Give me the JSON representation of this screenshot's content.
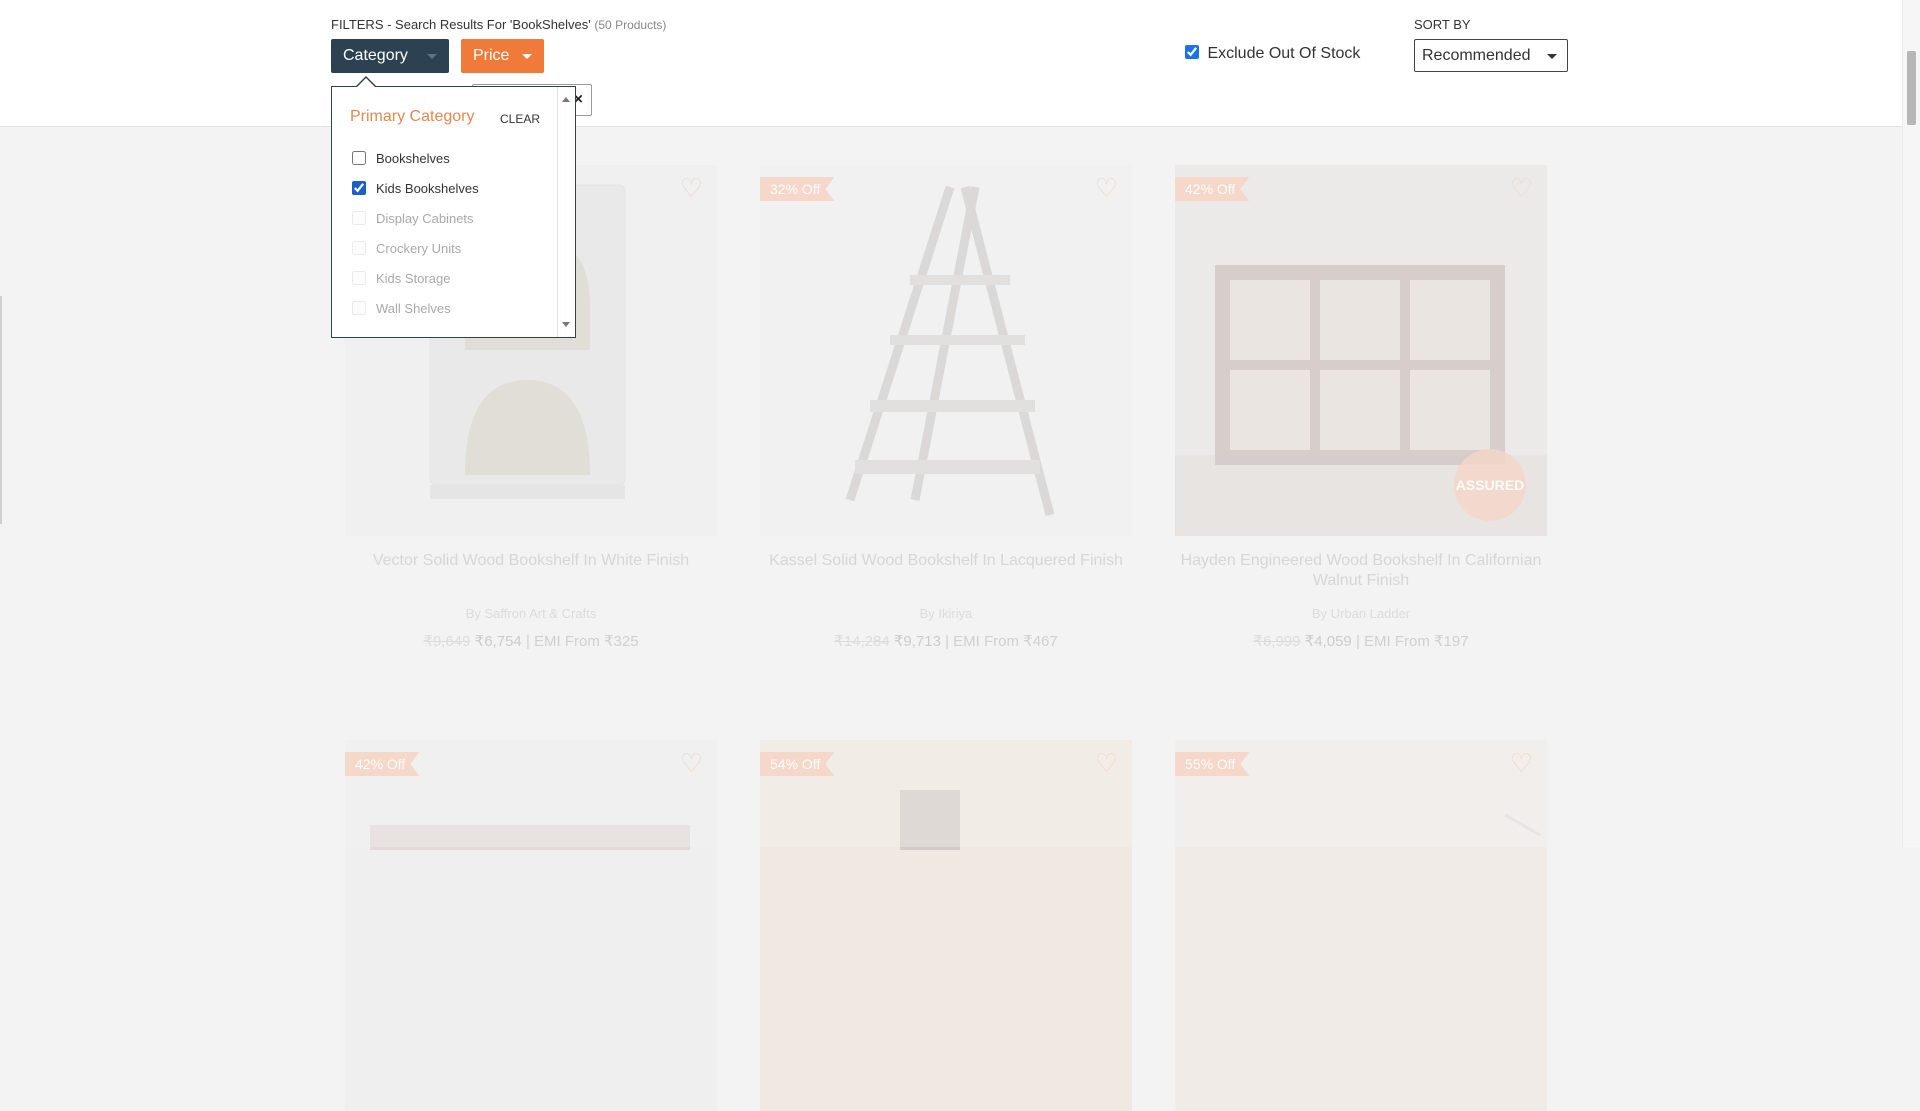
{
  "filterbar": {
    "title": "FILTERS - Search Results For 'BookShelves'",
    "count": "(50 Products)",
    "category_label": "Category",
    "price_label": "Price",
    "exclude_label": "Exclude Out Of Stock",
    "exclude_checked": true,
    "sort_label": "SORT BY",
    "sort_value": "Recommended"
  },
  "category_dropdown": {
    "heading": "Primary Category",
    "clear_label": "CLEAR",
    "items": [
      {
        "label": "Bookshelves",
        "checked": false,
        "enabled": true
      },
      {
        "label": "Kids Bookshelves",
        "checked": true,
        "enabled": true
      },
      {
        "label": "Display Cabinets",
        "checked": false,
        "enabled": false
      },
      {
        "label": "Crockery Units",
        "checked": false,
        "enabled": false
      },
      {
        "label": "Kids Storage",
        "checked": false,
        "enabled": false
      },
      {
        "label": "Wall Shelves",
        "checked": false,
        "enabled": false
      }
    ]
  },
  "products": [
    {
      "badge": "",
      "name": "Vector Solid Wood Bookshelf In White Finish",
      "brand": "By Saffron Art & Crafts",
      "mrp": "₹9,649",
      "price": "₹6,754",
      "emi": "| EMI From ₹325"
    },
    {
      "badge": "32% Off",
      "name": "Kassel Solid Wood Bookshelf In Lacquered Finish",
      "brand": "By Ikiriya",
      "mrp": "₹14,284",
      "price": "₹9,713",
      "emi": "| EMI From ₹467"
    },
    {
      "badge": "42% Off",
      "name": "Hayden Engineered Wood Bookshelf In Californian Walnut Finish",
      "brand": "By Urban Ladder",
      "mrp": "₹6,999",
      "price": "₹4,059",
      "emi": "| EMI From ₹197"
    },
    {
      "badge": "42% Off"
    },
    {
      "badge": "54% Off"
    },
    {
      "badge": "55% Off"
    }
  ],
  "assured_text": "ASSURED",
  "icons": {
    "heart": "heart-icon",
    "caret": "chevron-down-icon",
    "close": "close-icon"
  },
  "colors": {
    "category_button": "#2c4252",
    "price_button": "#f07a3a",
    "heading_orange": "#e08a52"
  }
}
